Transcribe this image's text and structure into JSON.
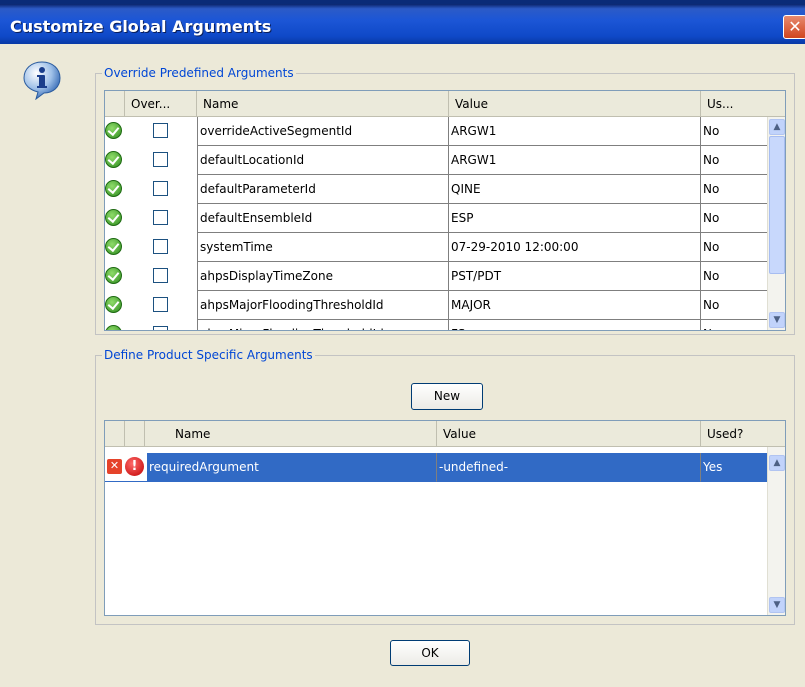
{
  "window": {
    "title": "Customize Global Arguments",
    "close_glyph": "✕"
  },
  "info_icon": "info-icon",
  "override_group": {
    "legend": "Override Predefined Arguments",
    "columns": [
      "Over...",
      "Name",
      "Value",
      "Us..."
    ],
    "rows": [
      {
        "name": "overrideActiveSegmentId",
        "value": "ARGW1",
        "used": "No"
      },
      {
        "name": "defaultLocationId",
        "value": "ARGW1",
        "used": "No"
      },
      {
        "name": "defaultParameterId",
        "value": "QINE",
        "used": "No"
      },
      {
        "name": "defaultEnsembleId",
        "value": "ESP",
        "used": "No"
      },
      {
        "name": "systemTime",
        "value": "07-29-2010 12:00:00",
        "used": "No"
      },
      {
        "name": "ahpsDisplayTimeZone",
        "value": "PST/PDT",
        "used": "No"
      },
      {
        "name": "ahpsMajorFloodingThresholdId",
        "value": "MAJOR",
        "used": "No"
      },
      {
        "name": "ahpsMinorFloodingThresholdId",
        "value": "FS",
        "used": "No"
      }
    ]
  },
  "product_group": {
    "legend": "Define Product Specific Arguments",
    "new_button": "New",
    "columns": [
      "Name",
      "Value",
      "Used?"
    ],
    "rows": [
      {
        "name": "requiredArgument",
        "value": "-undefined-",
        "used": "Yes",
        "selected": true
      }
    ]
  },
  "ok_button": "OK",
  "colors": {
    "accent": "#0046D5",
    "selection": "#316AC5",
    "title_bar": "#0F49C8"
  }
}
